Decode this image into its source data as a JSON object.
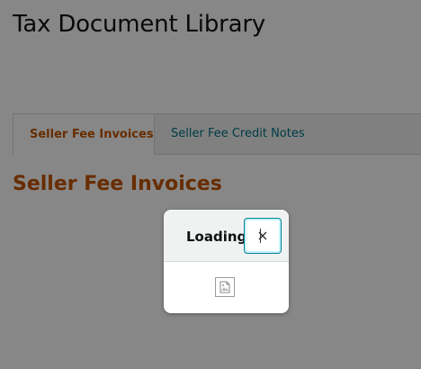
{
  "page": {
    "title": "Tax Document Library"
  },
  "tabs": [
    {
      "label": "Seller Fee Invoices",
      "active": true
    },
    {
      "label": "Seller Fee Credit Notes",
      "active": false
    }
  ],
  "section": {
    "title": "Seller Fee Invoices"
  },
  "modal": {
    "title": "Loading",
    "close_icon": "close-icon",
    "body_icon": "broken-image-icon"
  },
  "colors": {
    "accent": "#c45500",
    "link": "#007185",
    "focus_ring": "#008296",
    "overlay": "rgba(0,0,0,0.47)"
  }
}
